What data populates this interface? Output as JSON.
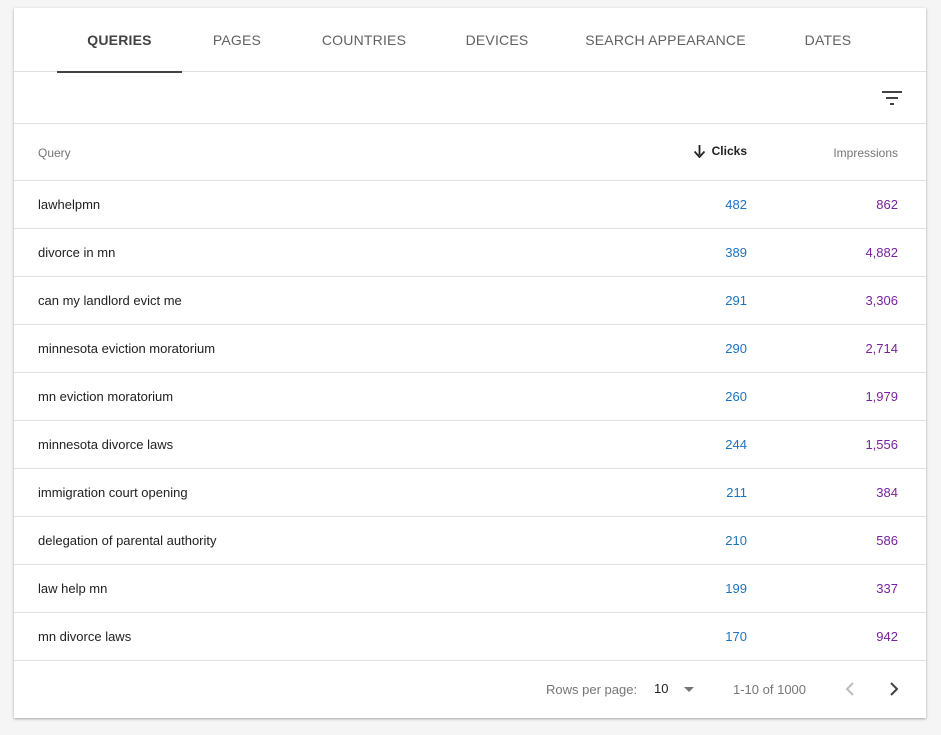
{
  "tabs": [
    {
      "label": "QUERIES",
      "active": true
    },
    {
      "label": "PAGES"
    },
    {
      "label": "COUNTRIES"
    },
    {
      "label": "DEVICES"
    },
    {
      "label": "SEARCH APPEARANCE"
    },
    {
      "label": "DATES"
    }
  ],
  "toolbar": {
    "filter_icon": "filter-list-icon"
  },
  "table": {
    "columns": {
      "query": "Query",
      "clicks": "Clicks",
      "impressions": "Impressions"
    },
    "sort_icon": "arrow-down-icon",
    "rows": [
      {
        "query": "lawhelpmn",
        "clicks": "482",
        "impressions": "862"
      },
      {
        "query": "divorce in mn",
        "clicks": "389",
        "impressions": "4,882"
      },
      {
        "query": "can my landlord evict me",
        "clicks": "291",
        "impressions": "3,306"
      },
      {
        "query": "minnesota eviction moratorium",
        "clicks": "290",
        "impressions": "2,714"
      },
      {
        "query": "mn eviction moratorium",
        "clicks": "260",
        "impressions": "1,979"
      },
      {
        "query": "minnesota divorce laws",
        "clicks": "244",
        "impressions": "1,556"
      },
      {
        "query": "immigration court opening",
        "clicks": "211",
        "impressions": "384"
      },
      {
        "query": "delegation of parental authority",
        "clicks": "210",
        "impressions": "586"
      },
      {
        "query": "law help mn",
        "clicks": "199",
        "impressions": "337"
      },
      {
        "query": "mn divorce laws",
        "clicks": "170",
        "impressions": "942"
      }
    ]
  },
  "footer": {
    "rows_per_page_label": "Rows per page:",
    "rows_per_page_value": "10",
    "range": "1-10 of 1000",
    "prev_icon": "chevron-left-icon",
    "next_icon": "chevron-right-icon"
  },
  "colors": {
    "clicks": "#1a73c1",
    "impressions": "#7b1fa2",
    "active_tab": "#424242"
  }
}
